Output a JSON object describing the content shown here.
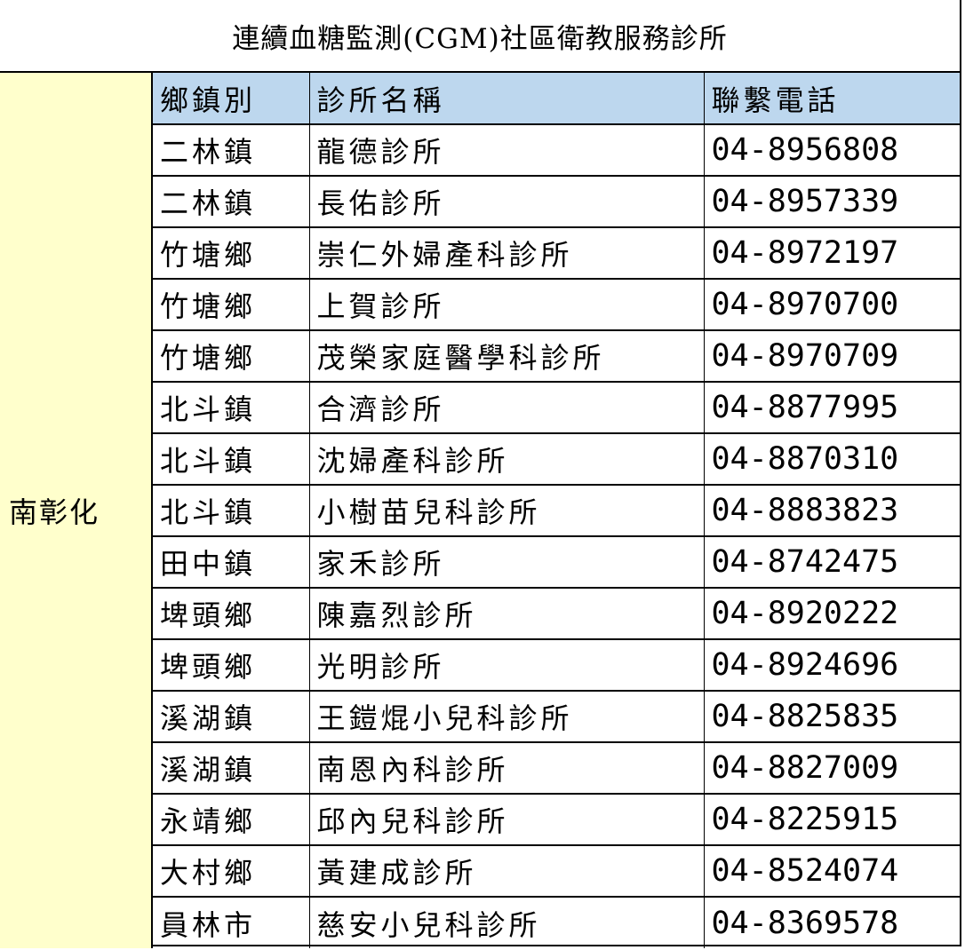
{
  "title": "連續血糖監測(CGM)社區衛教服務診所",
  "region": "南彰化",
  "headers": {
    "township": "鄉鎮別",
    "clinic": "診所名稱",
    "phone": "聯繫電話"
  },
  "rows": [
    {
      "township": "二林鎮",
      "clinic": "龍德診所",
      "phone": "04-8956808"
    },
    {
      "township": "二林鎮",
      "clinic": "長佑診所",
      "phone": "04-8957339"
    },
    {
      "township": "竹塘鄉",
      "clinic": "崇仁外婦產科診所",
      "phone": "04-8972197"
    },
    {
      "township": "竹塘鄉",
      "clinic": "上賀診所",
      "phone": "04-8970700"
    },
    {
      "township": "竹塘鄉",
      "clinic": "茂榮家庭醫學科診所",
      "phone": "04-8970709"
    },
    {
      "township": "北斗鎮",
      "clinic": "合濟診所",
      "phone": "04-8877995"
    },
    {
      "township": "北斗鎮",
      "clinic": "沈婦產科診所",
      "phone": "04-8870310"
    },
    {
      "township": "北斗鎮",
      "clinic": "小樹苗兒科診所",
      "phone": "04-8883823"
    },
    {
      "township": "田中鎮",
      "clinic": "家禾診所",
      "phone": "04-8742475"
    },
    {
      "township": "埤頭鄉",
      "clinic": "陳嘉烈診所",
      "phone": "04-8920222"
    },
    {
      "township": "埤頭鄉",
      "clinic": "光明診所",
      "phone": "04-8924696"
    },
    {
      "township": "溪湖鎮",
      "clinic": "王鎧焜小兒科診所",
      "phone": "04-8825835"
    },
    {
      "township": "溪湖鎮",
      "clinic": "南恩內科診所",
      "phone": "04-8827009"
    },
    {
      "township": "永靖鄉",
      "clinic": "邱內兒科診所",
      "phone": "04-8225915"
    },
    {
      "township": "大村鄉",
      "clinic": "黃建成診所",
      "phone": "04-8524074"
    },
    {
      "township": "員林市",
      "clinic": "慈安小兒科診所",
      "phone": "04-8369578"
    }
  ]
}
